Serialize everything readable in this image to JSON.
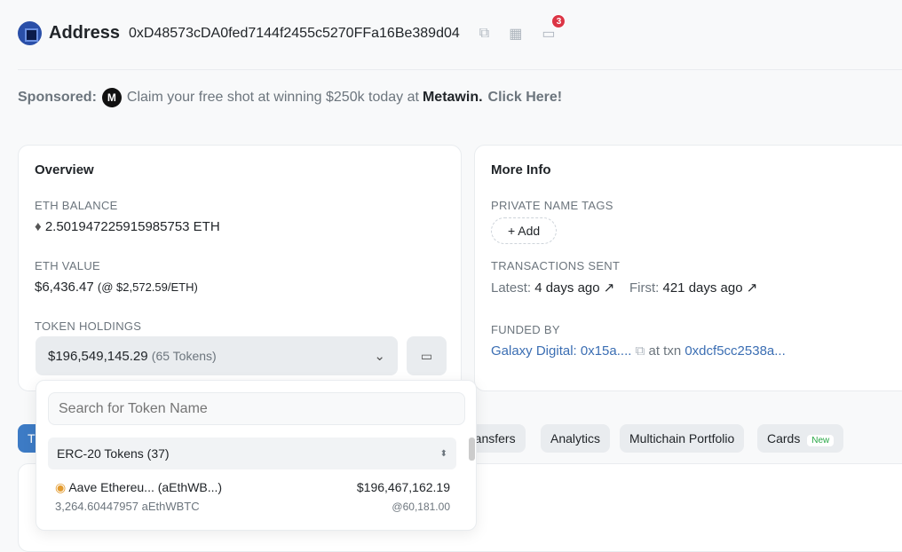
{
  "header": {
    "title": "Address",
    "address": "0xD48573cDA0fed7144f2455c5270FFa16Be389d04",
    "notification_count": "3"
  },
  "sponsored": {
    "label": "Sponsored:",
    "logo_text": "M",
    "text": "Claim your free shot at winning $250k today at",
    "brand": "Metawin.",
    "cta": "Click Here!"
  },
  "overview": {
    "title": "Overview",
    "eth_balance_label": "ETH BALANCE",
    "eth_balance": "2.501947225915985753 ETH",
    "eth_value_label": "ETH VALUE",
    "eth_value": "$6,436.47",
    "eth_price": "(@ $2,572.59/ETH)",
    "token_holdings_label": "TOKEN HOLDINGS",
    "token_value": "$196,549,145.29",
    "token_count": "(65 Tokens)"
  },
  "more_info": {
    "title": "More Info",
    "tags_label": "PRIVATE NAME TAGS",
    "add_label": "+ Add",
    "tx_sent_label": "TRANSACTIONS SENT",
    "latest_label": "Latest:",
    "latest": "4 days ago ↗",
    "first_label": "First:",
    "first": "421 days ago ↗",
    "funded_label": "FUNDED BY",
    "funded_by": "Galaxy Digital: 0x15a....",
    "at_txn": "at txn",
    "txn": "0xdcf5cc2538a..."
  },
  "tabs": [
    {
      "label": "T"
    },
    {
      "label": "ransfers"
    },
    {
      "label": "Analytics"
    },
    {
      "label": "Multichain Portfolio"
    },
    {
      "label": "Cards",
      "badge": "New"
    }
  ],
  "token_dropdown": {
    "search_placeholder": "Search for Token Name",
    "group_label": "ERC-20 Tokens (37)",
    "items": [
      {
        "name": "Aave Ethereu... (aEthWB...)",
        "value": "$196,467,162.19",
        "amount": "3,264.60447957 aEthWBTC",
        "price": "@60,181.00"
      }
    ]
  },
  "colors": {
    "link": "#3b6eb3",
    "accent": "#3d7bc5",
    "badge": "#dc3545"
  }
}
